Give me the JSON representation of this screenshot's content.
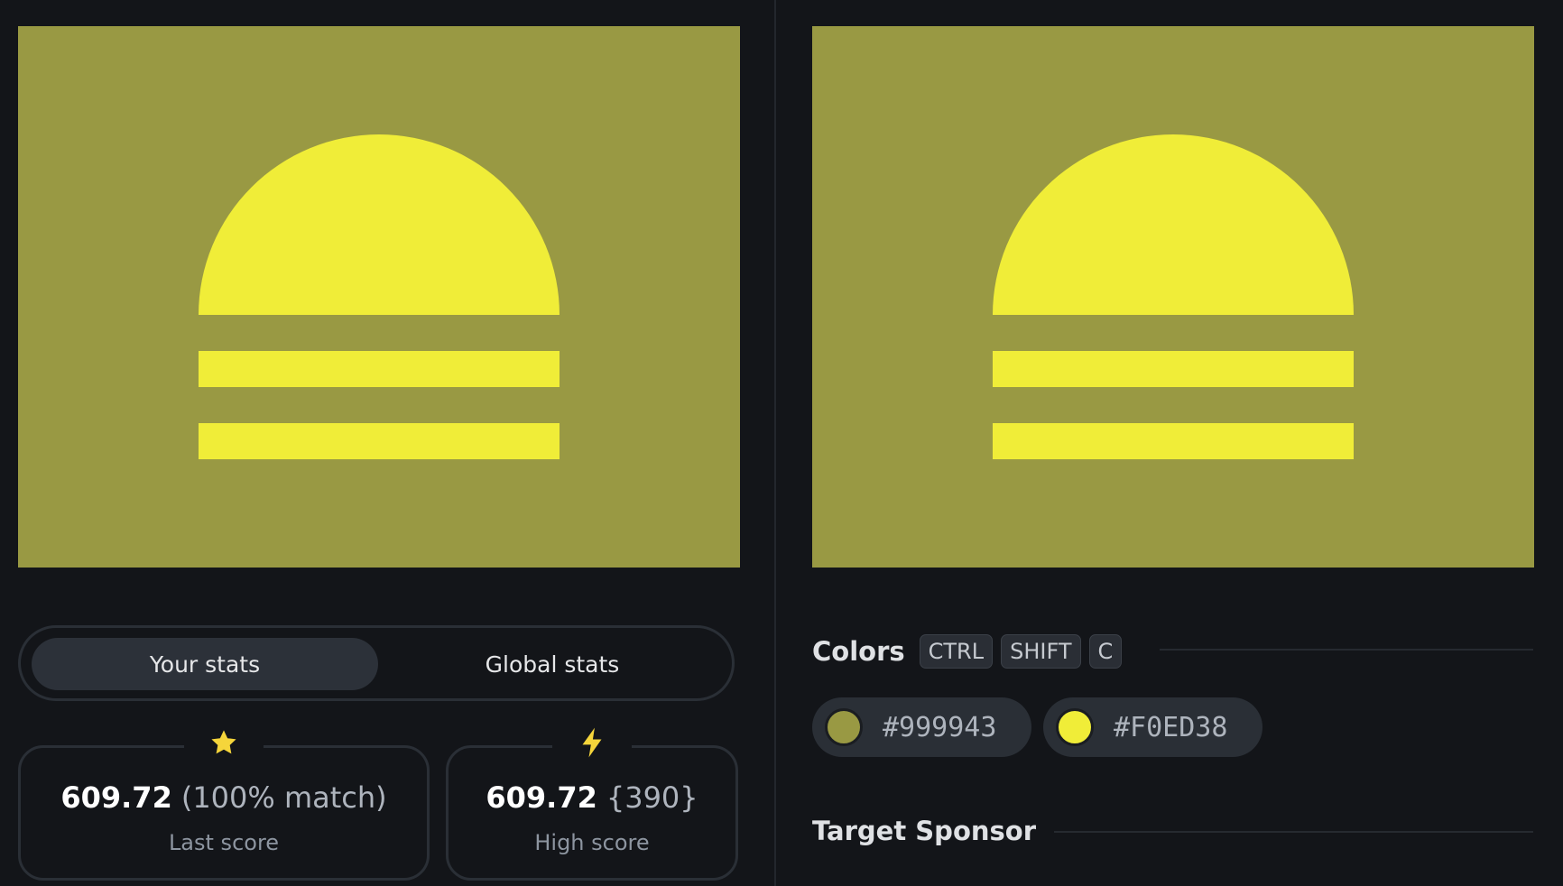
{
  "preview_left": {
    "background": "#999943",
    "shape_color": "#F0ED38"
  },
  "preview_right": {
    "background": "#999943",
    "shape_color": "#F0ED38"
  },
  "stats_toggle": {
    "your_stats": "Your stats",
    "global_stats": "Global stats",
    "active": "Your stats"
  },
  "last_score": {
    "icon": "star-icon",
    "value": "609.72",
    "extra": "(100% match)",
    "label": "Last score"
  },
  "high_score": {
    "icon": "bolt-icon",
    "value": "609.72",
    "extra": "{390}",
    "label": "High score"
  },
  "colors_section": {
    "title": "Colors",
    "shortcut": [
      "CTRL",
      "SHIFT",
      "C"
    ],
    "swatches": [
      {
        "hex": "#999943",
        "label": "#999943"
      },
      {
        "hex": "#F0ED38",
        "label": "#F0ED38"
      }
    ]
  },
  "sponsor_section": {
    "title": "Target Sponsor"
  },
  "accent": "#F5D53B"
}
